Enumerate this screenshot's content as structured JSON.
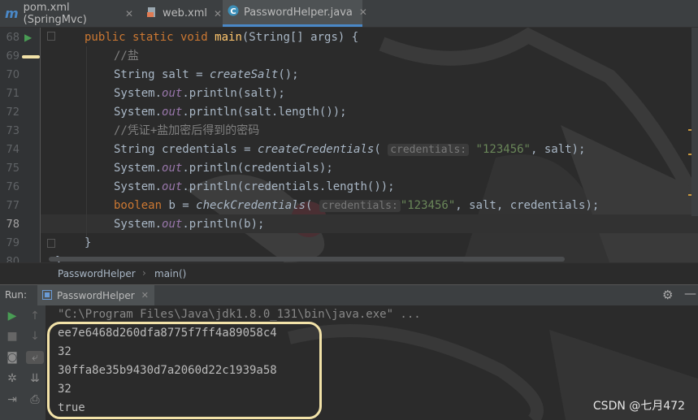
{
  "tabs": [
    {
      "icon": "m",
      "label": "pom.xml (SpringMvc)"
    },
    {
      "icon": "xml",
      "label": "web.xml"
    },
    {
      "icon": "C",
      "label": "PasswordHelper.java"
    }
  ],
  "editor": {
    "line_numbers": [
      "68",
      "69",
      "70",
      "71",
      "72",
      "73",
      "74",
      "75",
      "76",
      "77",
      "78",
      "79",
      "80"
    ],
    "lines": {
      "l68": {
        "kw1": "public static void ",
        "fn": "main",
        "rest": "(String[] args) {"
      },
      "l69": {
        "comment": "//盐"
      },
      "l70": {
        "a": "String salt = ",
        "call": "createSalt",
        "b": "();"
      },
      "l71": {
        "a": "System.",
        "out": "out",
        "b": ".println(salt);"
      },
      "l72": {
        "a": "System.",
        "out": "out",
        "b": ".println(salt.length());"
      },
      "l73": {
        "comment": "//凭证+盐加密后得到的密码"
      },
      "l74": {
        "a": "String credentials = ",
        "call": "createCredentials",
        "paren": "(",
        "hint": "credentials:",
        "str": "\"123456\"",
        "b": ", salt);"
      },
      "l75": {
        "a": "System.",
        "out": "out",
        "b": ".println(credentials);"
      },
      "l76": {
        "a": "System.",
        "out": "out",
        "b": ".println(credentials.length());"
      },
      "l77": {
        "kw": "boolean",
        "a": " b = ",
        "call": "checkCredentials",
        "paren": "(",
        "hint": "credentials:",
        "str": "\"123456\"",
        "b": ", salt, credentials);"
      },
      "l78": {
        "a": "System.",
        "out": "out",
        "b": ".println(b);"
      },
      "l79": {
        "a": "}"
      },
      "l80": {
        "a": "}"
      }
    }
  },
  "breadcrumb": {
    "class": "PasswordHelper",
    "sep": "›",
    "method": "main()"
  },
  "run": {
    "label": "Run:",
    "tab": "PasswordHelper",
    "cmd": "\"C:\\Program Files\\Java\\jdk1.8.0_131\\bin\\java.exe\" ...",
    "output": [
      "ee7e6468d260dfa8775f7ff4a89058c4",
      "32",
      "30ffa8e35b9430d7a2060d22c1939a58",
      "32",
      "true"
    ]
  },
  "watermark": "CSDN @七月472",
  "colors": {
    "accent": "#4a88c7",
    "highlight_box": "#f2e2a8",
    "keyword": "#cc7832",
    "string": "#6a8759"
  }
}
